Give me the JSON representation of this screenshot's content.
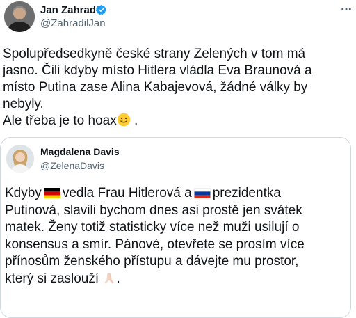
{
  "tweet": {
    "author_name": "Jan Zahradil",
    "author_handle": "@ZahradilJan",
    "text_lines": [
      "Spolupředsedkyně české strany Zelených v tom má",
      "jasno. Čili kdyby místo Hitlera vládla Eva Braunová a",
      "místo Putina zase Alina Kabajevová, žádné války by",
      "nebyly."
    ],
    "text_last": "Ale třeba je to hoax",
    "text_last_suffix": " .",
    "emoji_icon": "slightly-smiling-face-icon",
    "more_icon": "more-horizontal-icon"
  },
  "quote": {
    "author_name": "Magdalena Davis",
    "author_handle": "@ZelenaDavis",
    "line1_a": "Kdyby",
    "line1_b": "vedla Frau Hitlerová a",
    "line1_c": "prezidentka",
    "lines": [
      "Putinová, slavili bychom dnes asi prostě jen svátek",
      "matek. Ženy totiž statisticky více než muži usilují o",
      "konsensus a smír. Pánové, otevřete se prosím více",
      "přínosům ženského přístupu a dávejte mu prostor,"
    ],
    "last_line": "který si zaslouží",
    "last_suffix": ".",
    "flag_1": "germany-flag-icon",
    "flag_2": "russia-flag-icon",
    "pray_icon": "folded-hands-icon"
  },
  "colors": {
    "text": "#0f1419",
    "secondary": "#536471",
    "verified": "#1d9bf0",
    "border": "#cfd9de"
  }
}
